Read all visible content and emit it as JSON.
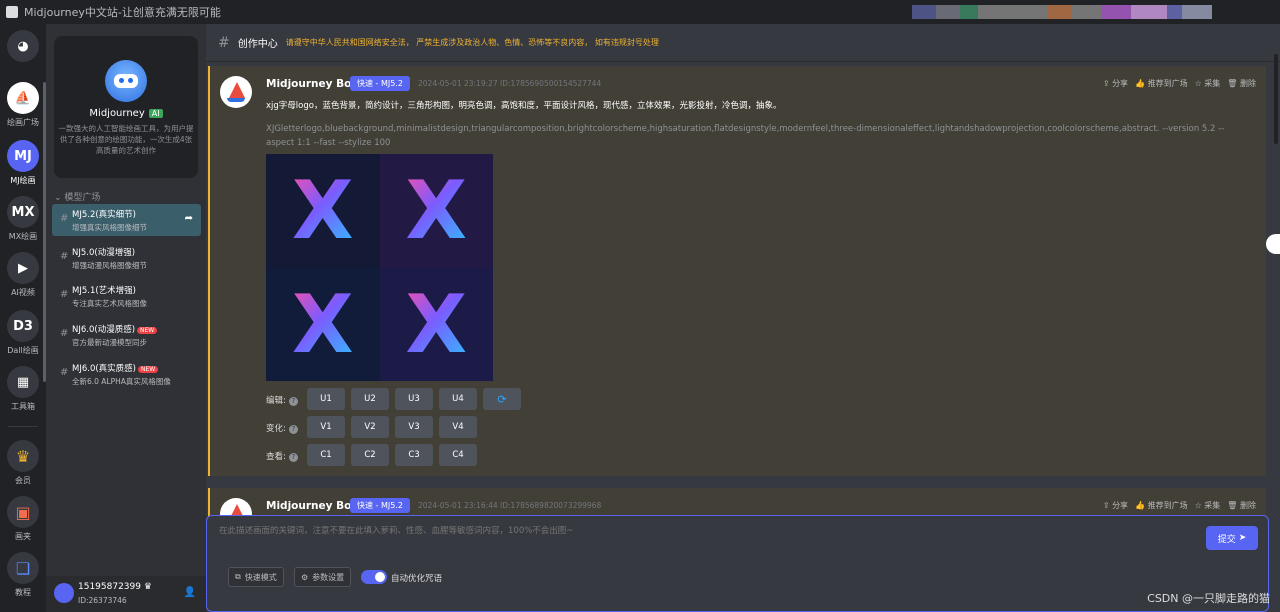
{
  "window": {
    "title": "Midjourney中文站-让创意充满无限可能"
  },
  "rail": {
    "items": [
      {
        "label": "",
        "glyph": "◕",
        "icon": "discord-icon"
      },
      {
        "label": "绘画广场",
        "glyph": "⛵",
        "icon": "sailboat-icon"
      },
      {
        "label": "MJ绘画",
        "glyph": "MJ"
      },
      {
        "label": "MX绘画",
        "glyph": "MX"
      },
      {
        "label": "AI视频",
        "glyph": "▶"
      },
      {
        "label": "Dall绘画",
        "glyph": "D3"
      },
      {
        "label": "工具箱",
        "glyph": "▦"
      },
      {
        "label": "会员",
        "glyph": "♛"
      },
      {
        "label": "画夹",
        "glyph": "▣"
      },
      {
        "label": "教程",
        "glyph": "❏"
      }
    ]
  },
  "sidebar": {
    "card": {
      "title": "Midjourney",
      "badge": "AI",
      "description": "一款强大的人工智能绘画工具，为用户提供了各种创意的绘图功能，一次生成4张高质量的艺术创作"
    },
    "section_label": "模型广场",
    "channels": [
      {
        "title": "MJ5.2(真实细节)",
        "subtitle": "增强真实风格图像细节",
        "active": true,
        "new": false
      },
      {
        "title": "NJ5.0(动漫增强)",
        "subtitle": "增强动漫风格图像细节",
        "active": false,
        "new": false
      },
      {
        "title": "MJ5.1(艺术增强)",
        "subtitle": "专注真实艺术风格图像",
        "active": false,
        "new": false
      },
      {
        "title": "NJ6.0(动漫质感)",
        "subtitle": "官方最新动漫模型同步",
        "active": false,
        "new": true
      },
      {
        "title": "MJ6.0(真实质感)",
        "subtitle": "全新6.0 ALPHA真实风格图像",
        "active": false,
        "new": true
      }
    ],
    "new_badge": "NEW",
    "user": {
      "name": "15195872399",
      "id": "ID:26373746"
    }
  },
  "header": {
    "channel_name": "创作中心",
    "notice": "请遵守中华人民共和国网络安全法， 严禁生成涉及政治人物、色情、恐怖等不良内容， 如有违规封号处理"
  },
  "messages": [
    {
      "author": "Midjourney Bot",
      "tag": "快速 - MJ5.2",
      "meta": "2024-05-01 23:19:27 ID:1785690500154527744",
      "actions": [
        "分享",
        "推荐到广场",
        "采集",
        "删除"
      ],
      "prompt_cn": "xjg字母logo，蓝色背景，简约设计，三角形构图，明亮色调，高饱和度，平面设计风格，现代感，立体效果，光影投射，冷色调，抽象。",
      "prompt_en": "XJGletterlogo,bluebackground,minimalistdesign,triangularcomposition,brightcolorscheme,highsaturation,flatdesignstyle,modernfeel,three-dimensionaleffect,lightandshadowprojection,coolcolorscheme,abstract. --version 5.2 --aspect 1:1 --fast --stylize 100",
      "tile_letter": "X",
      "rows": [
        {
          "label": "编辑:",
          "buttons": [
            "U1",
            "U2",
            "U3",
            "U4"
          ]
        },
        {
          "label": "变化:",
          "buttons": [
            "V1",
            "V2",
            "V3",
            "V4"
          ]
        },
        {
          "label": "查看:",
          "buttons": [
            "C1",
            "C2",
            "C3",
            "C4"
          ]
        }
      ]
    },
    {
      "author": "Midjourney Bot",
      "tag": "快速 - MJ5.2",
      "meta": "2024-05-01 23:16:44 ID:1785689820073299968",
      "actions": [
        "分享",
        "推荐到广场",
        "采集",
        "删除"
      ]
    }
  ],
  "composer": {
    "placeholder": "在此描述画面的关键词，注意不要在此填入萝莉、性感、血腥等敏感词内容，100%不会出图~",
    "submit": "提交",
    "fast_mode": "快速模式",
    "params": "参数设置",
    "auto_optimize": "自动优化咒语"
  },
  "watermark": "CSDN @一只脚走路的猫",
  "colors": {
    "accent": "#5865f2",
    "warning": "#f0b232",
    "message_bg": "#423f36",
    "active_channel": "#3b5e6b"
  }
}
